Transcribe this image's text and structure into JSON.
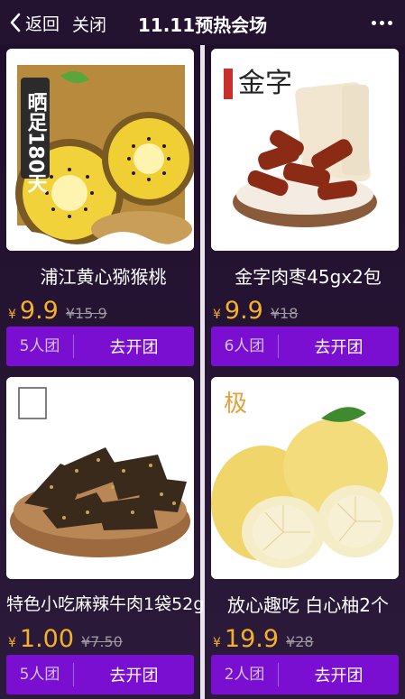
{
  "header": {
    "back_label": "返回",
    "close_label": "关闭",
    "title": "11.11预热会场"
  },
  "products": [
    {
      "name": "浦江黄心猕猴桃",
      "currency": "¥",
      "price": "9.9",
      "original_price": "¥15.9",
      "group_label": "5人团",
      "cta_label": "去开团",
      "image_text": "晒足180天"
    },
    {
      "name": "金字肉枣45gx2包",
      "currency": "¥",
      "price": "9.9",
      "original_price": "¥18",
      "group_label": "6人团",
      "cta_label": "去开团",
      "image_text": "金字"
    },
    {
      "name": "特色小吃麻辣牛肉1袋52g",
      "currency": "¥",
      "price": "1.00",
      "original_price": "¥7.50",
      "group_label": "5人团",
      "cta_label": "去开团",
      "image_text": ""
    },
    {
      "name": "放心趣吃 白心柚2个",
      "currency": "¥",
      "price": "19.9",
      "original_price": "¥28",
      "group_label": "2人团",
      "cta_label": "去开团",
      "image_text": ""
    }
  ]
}
